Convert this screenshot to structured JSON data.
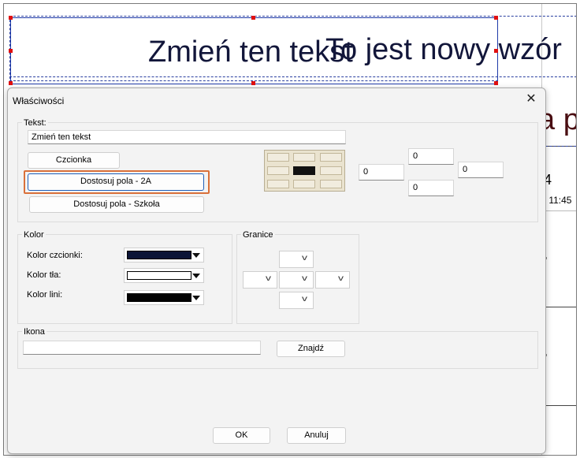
{
  "background": {
    "text_one": "Zmień ten tekst",
    "text_two": "To jest nowy wzór",
    "text_three": "a p",
    "side_num": "4",
    "side_time": "- 11:45"
  },
  "dialog": {
    "title": "Właściwości",
    "close_glyph": "✕",
    "text_group": {
      "label": "Tekst:",
      "value": "Zmień ten tekst",
      "font_button": "Czcionka",
      "fit_2a_button": "Dostosuj pola - 2A",
      "fit_school_button": "Dostosuj pola - Szkoła",
      "margin_top": "0",
      "margin_left": "0",
      "margin_right": "0",
      "margin_bottom": "0",
      "alignment_selected": "middle-center"
    },
    "color_group": {
      "label": "Kolor",
      "font_color_label": "Kolor czcionki:",
      "font_color": "#0b1436",
      "bg_color_label": "Kolor tła:",
      "bg_color": "#ffffff",
      "line_color_label": "Kolor lini:",
      "line_color": "#000000"
    },
    "borders_group": {
      "label": "Granice",
      "dropdown_icon": "chevron-down-icon"
    },
    "icon_group": {
      "label": "Ikona",
      "value": "",
      "find_button": "Znajdź"
    },
    "ok_button": "OK",
    "cancel_button": "Anuluj"
  }
}
